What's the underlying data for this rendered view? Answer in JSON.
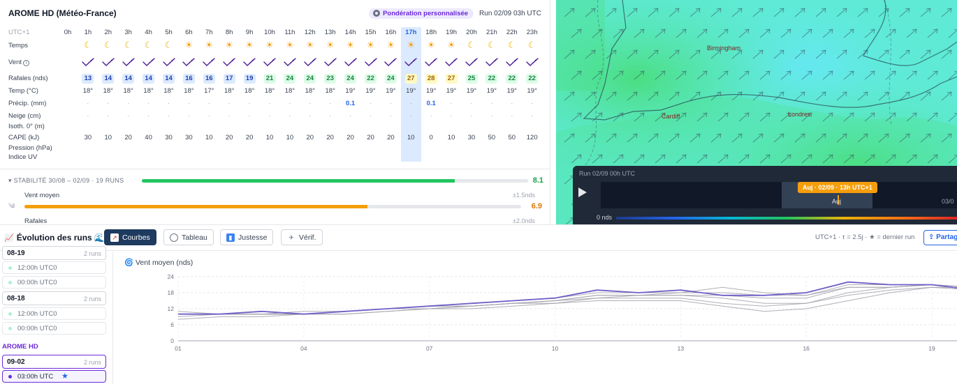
{
  "forecast": {
    "title": "AROME HD (Météo-France)",
    "badge": "Pondération personnalisée",
    "run": "Run 02/09 03h UTC",
    "timezone": "UTC+1",
    "highlight_hour": "17h",
    "labels": {
      "weather": "Temps",
      "wind": "Vent",
      "gusts": "Rafales (nds)",
      "temp": "Temp (°C)",
      "precip": "Précip. (mm)",
      "snow": "Neige (cm)",
      "iso0": "Isoth. 0° (m)",
      "cape": "CAPE (kJ)",
      "pressure": "Pression (hPa)",
      "uv": "Indice UV"
    },
    "hours": [
      "0h",
      "1h",
      "2h",
      "3h",
      "4h",
      "5h",
      "6h",
      "7h",
      "8h",
      "9h",
      "10h",
      "11h",
      "12h",
      "13h",
      "14h",
      "15h",
      "16h",
      "17h",
      "18h",
      "19h",
      "20h",
      "21h",
      "22h",
      "23h"
    ],
    "weather": [
      "",
      "moon",
      "moon",
      "moon",
      "moon",
      "moon",
      "sun",
      "sun",
      "sun",
      "sun",
      "sun",
      "sun",
      "sun",
      "sun",
      "sun",
      "sun",
      "sun",
      "sun",
      "sun",
      "sun",
      "moon",
      "moon",
      "moon",
      "moon"
    ],
    "gusts": [
      "",
      "13",
      "14",
      "14",
      "14",
      "14",
      "16",
      "16",
      "17",
      "19",
      "21",
      "24",
      "24",
      "23",
      "24",
      "22",
      "24",
      "27",
      "28",
      "27",
      "25",
      "22",
      "22",
      "22"
    ],
    "temp": [
      "",
      "18°",
      "18°",
      "18°",
      "18°",
      "18°",
      "18°",
      "17°",
      "18°",
      "18°",
      "18°",
      "18°",
      "18°",
      "18°",
      "19°",
      "19°",
      "19°",
      "19°",
      "19°",
      "19°",
      "19°",
      "19°",
      "19°",
      "19°"
    ],
    "precip": [
      "",
      "-",
      "-",
      "-",
      "-",
      "-",
      "-",
      "-",
      "-",
      "-",
      "-",
      "-",
      "-",
      "-",
      "0.1",
      "-",
      "-",
      "-",
      "0.1",
      "-",
      "-",
      "-",
      "-",
      "-"
    ],
    "snow": [
      "",
      "-",
      "-",
      "-",
      "-",
      "-",
      "-",
      "-",
      "-",
      "-",
      "-",
      "-",
      "-",
      "-",
      "-",
      "-",
      "-",
      "-",
      "-",
      "-",
      "-",
      "-",
      "-",
      "-"
    ],
    "cape": [
      "",
      "30",
      "10",
      "20",
      "40",
      "30",
      "30",
      "10",
      "20",
      "20",
      "10",
      "10",
      "20",
      "20",
      "20",
      "20",
      "20",
      "10",
      "0",
      "10",
      "30",
      "50",
      "50",
      "120"
    ]
  },
  "stability": {
    "label": "STABILITÉ 30/08 – 02/09 · 19 RUNS",
    "score": "8.1",
    "score_fraction": 0.81,
    "metrics": [
      {
        "label": "Vent moyen",
        "pm": "±1.5nds",
        "score": "6.9",
        "fraction": 0.69
      },
      {
        "label": "Rafales",
        "pm": "±2.0nds"
      }
    ]
  },
  "map": {
    "cities": [
      "Birmingham",
      "Cardiff",
      "Londres"
    ],
    "run": "Run 02/09 00h UTC",
    "time_chip": "Auj · 02/09 · 13h UTC+1",
    "today": "Auj",
    "next": "03/0",
    "legend_zero": "0 nds"
  },
  "evolution": {
    "title": "Évolution des runs",
    "tabs": [
      "Courbes",
      "Tableau",
      "Justesse",
      "Vérif."
    ],
    "meta": "UTC+1 · τ = 2.5j · ★ = dernier run",
    "share": "Partager",
    "sidebar": {
      "days": [
        {
          "name": "08-19",
          "count": "2 runs",
          "runs": [
            "12:00h UTC0",
            "00:00h UTC0"
          ]
        },
        {
          "name": "08-18",
          "count": "2 runs",
          "runs": [
            "12:00h UTC0",
            "00:00h UTC0"
          ]
        }
      ],
      "model": "AROME HD",
      "selected_day": {
        "name": "09-02",
        "count": "2 runs",
        "run": "03:00h UTC"
      }
    },
    "chart_title": "Vent moyen (nds)"
  },
  "chart_data": {
    "type": "line",
    "title": "Vent moyen (nds)",
    "x": [
      "01",
      "02",
      "03",
      "04",
      "05",
      "06",
      "07",
      "08",
      "09",
      "10",
      "11",
      "12",
      "13",
      "14",
      "15",
      "16",
      "17",
      "18",
      "19",
      "20"
    ],
    "ylim": [
      0,
      24
    ],
    "yticks": [
      0,
      6,
      12,
      18,
      24
    ],
    "xticks": [
      "01",
      "04",
      "07",
      "10",
      "13",
      "16",
      "19"
    ],
    "series": [
      {
        "values": [
          10,
          10,
          11,
          10,
          11,
          12,
          13,
          14,
          15,
          16,
          19,
          18,
          19,
          17,
          17,
          18,
          22,
          21,
          21,
          19
        ],
        "latest": true
      },
      {
        "values": [
          11,
          10,
          10,
          10,
          11,
          12,
          13,
          14,
          15,
          16,
          18,
          18,
          18,
          18,
          17,
          17,
          21,
          21,
          21,
          19
        ]
      },
      {
        "values": [
          10,
          10,
          10,
          11,
          11,
          12,
          13,
          13,
          14,
          15,
          17,
          17,
          18,
          20,
          18,
          17,
          20,
          20,
          21,
          20
        ]
      },
      {
        "values": [
          10,
          10,
          10,
          10,
          11,
          12,
          13,
          13,
          14,
          15,
          17,
          17,
          17,
          17,
          16,
          16,
          20,
          20,
          21,
          20
        ]
      },
      {
        "values": [
          9,
          10,
          10,
          10,
          11,
          12,
          12,
          13,
          14,
          15,
          16,
          17,
          17,
          16,
          14,
          14,
          18,
          20,
          21,
          20
        ]
      },
      {
        "values": [
          10,
          10,
          10,
          10,
          10,
          11,
          12,
          13,
          14,
          14,
          16,
          16,
          16,
          14,
          13,
          14,
          17,
          19,
          20,
          20
        ]
      },
      {
        "values": [
          8,
          9,
          9,
          10,
          10,
          11,
          12,
          12,
          13,
          14,
          15,
          15,
          15,
          13,
          11,
          12,
          15,
          18,
          20,
          19
        ]
      }
    ]
  }
}
